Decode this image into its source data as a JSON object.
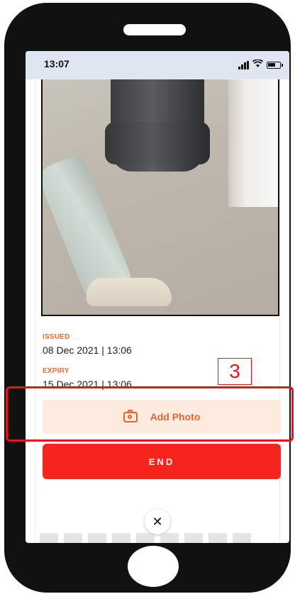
{
  "status_bar": {
    "time": "13:07",
    "icons": [
      "signal-icon",
      "wifi-icon",
      "battery-icon"
    ]
  },
  "permit": {
    "issued_label": "ISSUED",
    "issued_value": "08 Dec 2021 | 13:06",
    "expiry_label": "EXPIRY",
    "expiry_value": "15 Dec 2021 | 13:06"
  },
  "actions": {
    "add_photo_label": "Add Photo",
    "end_label": "END",
    "close_symbol": "✕"
  },
  "annotation": {
    "number": "3"
  },
  "colors": {
    "accent_orange": "#e2642f",
    "end_red": "#f5241c",
    "annotation_red": "#e8141c"
  }
}
